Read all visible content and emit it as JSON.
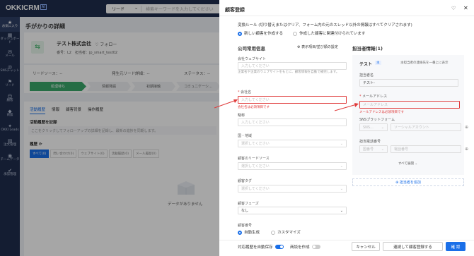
{
  "topbar": {
    "logo": "OKKICRM",
    "logo_badge": "AI",
    "search_select": "リード",
    "search_placeholder": "検索キーワードを入力してください"
  },
  "sidebar": [
    {
      "icon": "star-icon",
      "glyph": "★",
      "label": "お気に入り",
      "active": true
    },
    {
      "icon": "dashboard-icon",
      "glyph": "▦",
      "label": "ダッシュボード"
    },
    {
      "icon": "mail-icon",
      "glyph": "✉",
      "label": "メール"
    },
    {
      "icon": "sns-icon",
      "glyph": "◎",
      "label": "SNSチャット"
    },
    {
      "icon": "lead-icon",
      "glyph": "⚑",
      "label": "リード"
    },
    {
      "icon": "customer-icon",
      "glyph": "☺",
      "label": "顧客"
    },
    {
      "icon": "deal-icon",
      "glyph": "◆",
      "label": "商談"
    },
    {
      "icon": "okki-leads-icon",
      "glyph": "✦",
      "label": "OKKI Leads"
    },
    {
      "icon": "order-icon",
      "glyph": "▤",
      "label": "注文管理"
    },
    {
      "icon": "team-icon",
      "glyph": "◉",
      "label": "チームデータ"
    },
    {
      "icon": "approval-icon",
      "glyph": "✔",
      "label": "承認管理"
    }
  ],
  "page": {
    "title": "手がかりの詳細",
    "company_name": "テスト株式会社",
    "follow": "♡ フォロー",
    "meta": "番号：L2　担当者：jp_smart_test02",
    "lead_source_label": "リードソース：--",
    "origin_label": "発生元リード詳細：--",
    "status_label": "ステータス：--",
    "steps": [
      "処理待ち",
      "情報発掘",
      "初期接触",
      "コミュニケーシ..."
    ],
    "tabs": [
      "活動履歴",
      "情報",
      "顧客背景",
      "操作履歴"
    ],
    "activity_title": "活動履歴を記録",
    "activity_placeholder": "ここをクリックしてフォローアップの詳細を記録し、最新の進捗を同期します。",
    "history_label": "履歴",
    "filters": [
      "すべて(0)",
      "問い合わせ(0)",
      "ウェブサイト(0)",
      "活動履歴(0)",
      "メール履歴(0)"
    ],
    "empty_text": "データがありません"
  },
  "drawer": {
    "title": "顧客登録",
    "rule_text": "変換ルール (切り替えまたはクリア、フォーム内の元のスレッド以外の情報はすべてクリアされます)",
    "radio_new": "新しい顧客を作成する",
    "radio_existing": "作成した顧客に関連付けられています",
    "company_section": "公司常用信息",
    "settings_link": "⚙ 表示項目/並び順の設定",
    "website_label": "会社ウェブサイト",
    "website_placeholder": "入力してください",
    "website_help": "企業名や企業のウェブサイトをもとに、顧客情報を自動で補完します。",
    "company_label": "会社名",
    "company_placeholder": "入力してください",
    "company_error": "会社名は必須項目です",
    "short_label": "略称",
    "short_placeholder": "入力してください",
    "country_label": "国・地域",
    "country_placeholder": "選択してください",
    "source_label": "顧客のリードソース",
    "source_placeholder": "選択してください",
    "tag_label": "顧客タグ",
    "tag_placeholder": "選択してください",
    "phase_label": "顧客フェーズ",
    "phase_value": "なし",
    "number_label": "顧客番号",
    "auto_label": "自動生成",
    "custom_label": "カスタマイズ",
    "contact_section": "担当者情報(1)",
    "contact_name": "テスト",
    "contact_tag": "主",
    "contact_main": "主担当者の連絡先を一番上に表示",
    "person_label": "担当者名",
    "person_value": "テスト-",
    "email_label": "メールアドレス",
    "email_placeholder": "メールアドレス",
    "email_error": "メールアドレスは必須項目です",
    "sns_label": "SNSプラットフォーム",
    "sns_select": "SNS...",
    "sns_placeholder": "ソーシャルアカウント",
    "phone_label": "担当電話番号",
    "phone_select": "国番号",
    "phone_placeholder": "電話番号",
    "expand_all": "すべて展開 ⌄",
    "add_contact": "⊕ 担当者を追加",
    "auto_save": "対応履歴を自動保存",
    "create_deal": "商談を作成",
    "cancel": "キャンセル",
    "continue": "連続して顧客登録する",
    "confirm": "確 認"
  }
}
